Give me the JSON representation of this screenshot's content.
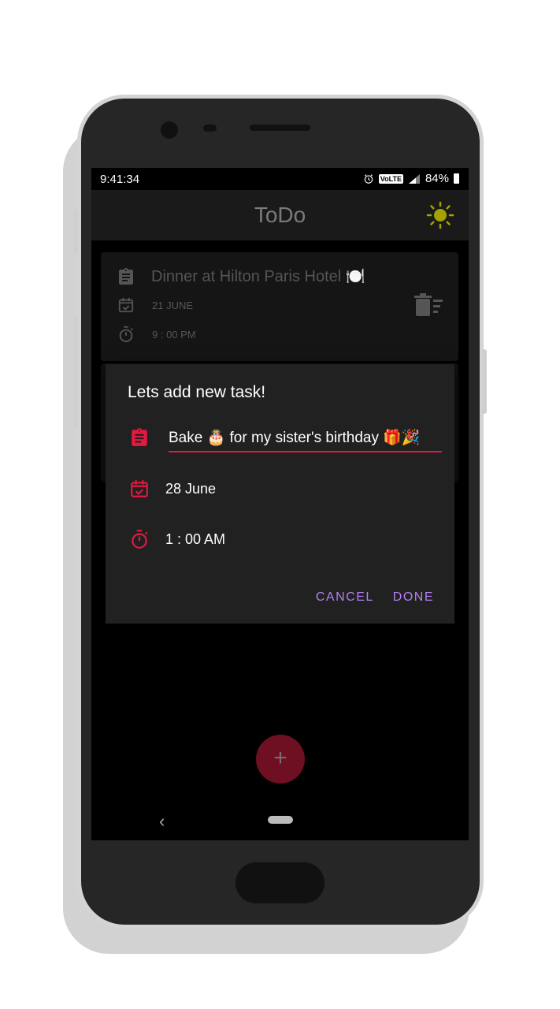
{
  "status_bar": {
    "time": "9:41:34",
    "volte_label": "VoLTE",
    "battery_pct": "84%"
  },
  "app": {
    "title": "ToDo",
    "theme_icon": "sun-icon"
  },
  "task_list": [
    {
      "title": "Dinner at Hilton Paris Hotel 🍽️",
      "date": "21 JUNE",
      "time": "9 : 00 PM"
    }
  ],
  "dialog": {
    "title": "Lets add new task!",
    "task_value": "Bake 🎂 for my sister's birthday 🎁🎉",
    "date_value": "28 June",
    "time_value": "1 : 00 AM",
    "cancel_label": "CANCEL",
    "done_label": "DONE"
  },
  "fab_label": "+",
  "colors": {
    "accent": "#e3193f",
    "button_text": "#b37ff3",
    "fab": "#6e0f22",
    "sun": "#a5a100"
  }
}
